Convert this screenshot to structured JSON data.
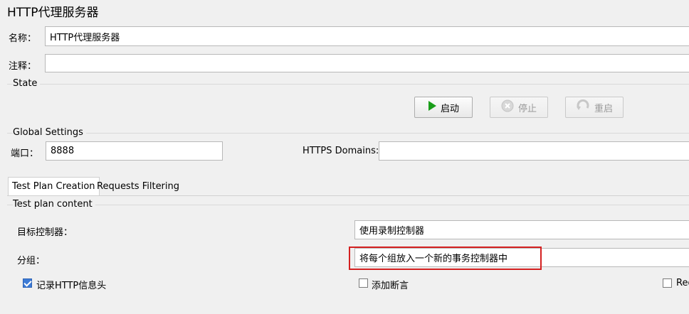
{
  "title": "HTTP代理服务器",
  "name_label": "名称：",
  "name_value": "HTTP代理服务器",
  "comment_label": "注释：",
  "comment_value": "",
  "state_group": "State",
  "buttons": {
    "start": "启动",
    "stop": "停止",
    "restart": "重启"
  },
  "global_group": "Global Settings",
  "port_label": "端口：",
  "port_value": "8888",
  "https_label": "HTTPS Domains:",
  "https_value": "",
  "tabs": [
    "Test Plan Creation",
    "Requests Filtering"
  ],
  "content_group": "Test plan content",
  "target_label": "目标控制器：",
  "target_value": "使用录制控制器",
  "grouping_label": "分组：",
  "grouping_value": "将每个组放入一个新的事务控制器中",
  "checkboxes": [
    {
      "label": "记录HTTP信息头",
      "checked": true
    },
    {
      "label": "添加断言",
      "checked": false
    },
    {
      "label": "Reg",
      "checked": false
    }
  ],
  "colors": {
    "start_icon": "#1a9e1a",
    "highlight_box": "#d42020",
    "checkbox_checked": "#3d7bd6"
  }
}
